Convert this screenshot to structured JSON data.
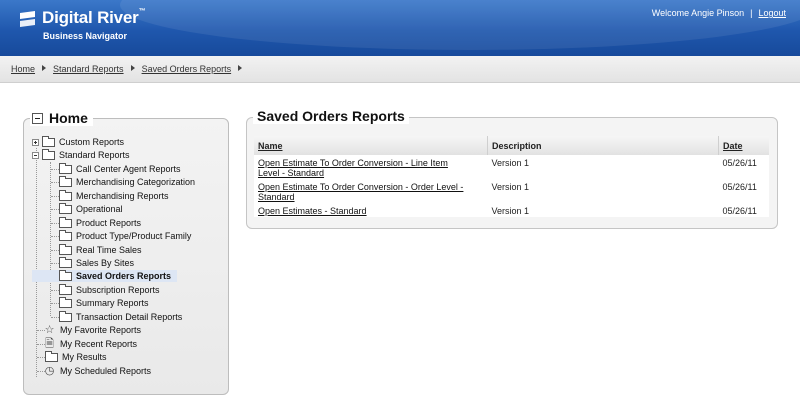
{
  "header": {
    "brand": "Digital River",
    "brand_mark": "™",
    "product": "Business Navigator",
    "welcome": "Welcome Angie Pinson",
    "separator": "|",
    "logout": "Logout"
  },
  "breadcrumb": {
    "items": [
      "Home",
      "Standard Reports",
      "Saved Orders Reports"
    ]
  },
  "sidebar": {
    "title": "Home",
    "tree": [
      {
        "label": "Custom Reports",
        "icon": "folder-icon",
        "toggle": "expand"
      },
      {
        "label": "Standard Reports",
        "icon": "folder-open-icon",
        "toggle": "collapse"
      },
      {
        "label": "Call Center Agent Reports",
        "icon": "folder-icon"
      },
      {
        "label": "Merchandising Categorization",
        "icon": "folder-icon"
      },
      {
        "label": "Merchandising Reports",
        "icon": "folder-icon"
      },
      {
        "label": "Operational",
        "icon": "folder-icon"
      },
      {
        "label": "Product Reports",
        "icon": "folder-icon"
      },
      {
        "label": "Product Type/Product Family",
        "icon": "folder-icon"
      },
      {
        "label": "Real Time Sales",
        "icon": "folder-icon"
      },
      {
        "label": "Sales By Sites",
        "icon": "folder-icon"
      },
      {
        "label": "Saved Orders Reports",
        "icon": "folder-icon",
        "selected": true
      },
      {
        "label": "Subscription Reports",
        "icon": "folder-icon"
      },
      {
        "label": "Summary Reports",
        "icon": "folder-icon"
      },
      {
        "label": "Transaction Detail Reports",
        "icon": "folder-icon"
      },
      {
        "label": "My Favorite Reports",
        "icon": "star-icon"
      },
      {
        "label": "My Recent Reports",
        "icon": "document-icon"
      },
      {
        "label": "My Results",
        "icon": "folder-icon"
      },
      {
        "label": "My Scheduled Reports",
        "icon": "clock-icon"
      }
    ]
  },
  "main": {
    "title": "Saved Orders Reports",
    "columns": {
      "name": "Name",
      "description": "Description",
      "date": "Date"
    },
    "rows": [
      {
        "name_line1": "Open Estimate To Order Conversion - Line Item",
        "name_line2": "Level - Standard",
        "description": "Version 1",
        "date": "05/26/11"
      },
      {
        "name_line1": "Open Estimate To Order Conversion - Order Level -",
        "name_line2": "Standard",
        "description": "Version 1",
        "date": "05/26/11"
      },
      {
        "name_line1": "Open Estimates - Standard",
        "name_line2": "",
        "description": "Version 1",
        "date": "05/26/11"
      }
    ]
  },
  "colors": {
    "header_blue": "#1f57ad",
    "selected_bg": "#dde6f4"
  }
}
